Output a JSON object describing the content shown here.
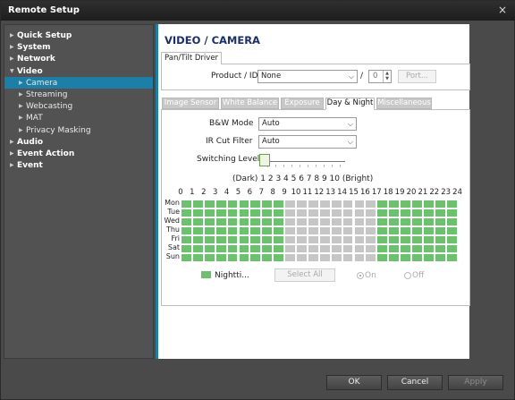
{
  "window": {
    "title": "Remote Setup",
    "close_glyph": "×"
  },
  "sidebar": {
    "items": [
      {
        "label": "Quick Setup",
        "level": "top",
        "expander": "▶"
      },
      {
        "label": "System",
        "level": "top",
        "expander": "▶"
      },
      {
        "label": "Network",
        "level": "top",
        "expander": "▶"
      },
      {
        "label": "Video",
        "level": "top",
        "expander": "▼"
      },
      {
        "label": "Camera",
        "level": "sub",
        "expander": "▶",
        "selected": true
      },
      {
        "label": "Streaming",
        "level": "sub",
        "expander": "▶"
      },
      {
        "label": "Webcasting",
        "level": "sub",
        "expander": "▶"
      },
      {
        "label": "MAT",
        "level": "sub",
        "expander": "▶"
      },
      {
        "label": "Privacy Masking",
        "level": "sub",
        "expander": "▶"
      },
      {
        "label": "Audio",
        "level": "top",
        "expander": "▶"
      },
      {
        "label": "Event Action",
        "level": "top",
        "expander": "▶"
      },
      {
        "label": "Event",
        "level": "top",
        "expander": "▶"
      }
    ]
  },
  "main": {
    "page_title": "VIDEO / CAMERA",
    "pan_tilt": {
      "tab_label": "Pan/Tilt Driver",
      "product_label": "Product / ID",
      "product_value": "None",
      "separator": "/",
      "id_value": "0",
      "port_button": "Port..."
    },
    "tabs": [
      {
        "label": "Image Sensor",
        "active": false
      },
      {
        "label": "White Balance",
        "active": false
      },
      {
        "label": "Exposure",
        "active": false
      },
      {
        "label": "Day & Night",
        "active": true
      },
      {
        "label": "Miscellaneous",
        "active": false
      }
    ],
    "day_night": {
      "bw_mode_label": "B&W Mode",
      "bw_mode_value": "Auto",
      "ir_cut_label": "IR Cut Filter",
      "ir_cut_value": "Auto",
      "switching_label": "Switching Level",
      "switching_level": 1,
      "switching_max": 10,
      "scale_dark": "(Dark)",
      "scale_numbers": "1 2 3 4 5 6 7 8 9 10",
      "scale_bright": "(Bright)",
      "hours": [
        "0",
        "1",
        "2",
        "3",
        "4",
        "5",
        "6",
        "7",
        "8",
        "9",
        "10",
        "11",
        "12",
        "13",
        "14",
        "15",
        "16",
        "17",
        "18",
        "19",
        "20",
        "21",
        "22",
        "23",
        "24"
      ],
      "days": [
        "Mon",
        "Tue",
        "Wed",
        "Thu",
        "Fri",
        "Sat",
        "Sun"
      ],
      "night_hours": [
        0,
        1,
        2,
        3,
        4,
        5,
        6,
        7,
        8,
        17,
        18,
        19,
        20,
        21,
        22,
        23
      ],
      "legend_label": "Nightti...",
      "select_all": "Select All",
      "radio_on": "On",
      "radio_off": "Off"
    }
  },
  "footer": {
    "ok": "OK",
    "cancel": "Cancel",
    "apply": "Apply"
  },
  "colors": {
    "accent": "#1b7fa8",
    "night": "#6ac26c",
    "day": "#c6c6c6",
    "title_navy": "#1a2f6e"
  }
}
